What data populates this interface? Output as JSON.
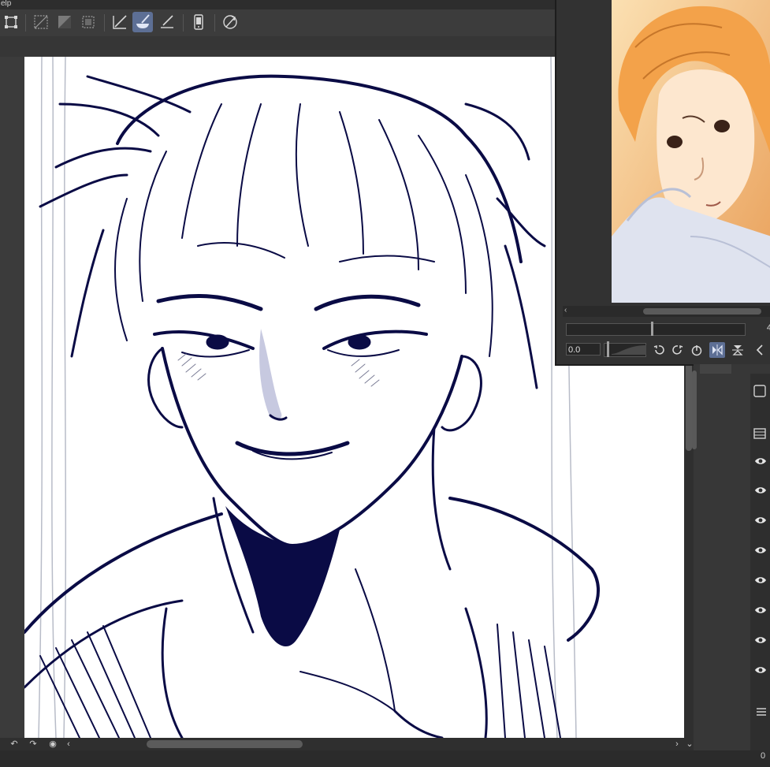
{
  "app": {
    "menu_fragment": "elp"
  },
  "toolbar": {
    "tools": [
      {
        "icon": "transform-icon"
      },
      {
        "icon": "select-clear-icon"
      },
      {
        "icon": "select-invert-icon"
      },
      {
        "icon": "select-extend-icon"
      },
      {
        "icon": "ruler-pen-icon"
      },
      {
        "icon": "brush-icon",
        "active": true
      },
      {
        "icon": "ruler-line-icon"
      },
      {
        "icon": "device-icon"
      },
      {
        "icon": "settings-wand-icon"
      }
    ],
    "active_color": "#5d6f95"
  },
  "navigator": {
    "zoom_fragment": "4",
    "rotation_value": "0.0"
  },
  "layers": {
    "visible_count": 8,
    "footer_value": "0"
  },
  "colors": {
    "ink": "#0a0b45",
    "canvas_bg": "#ffffff",
    "ui_dark": "#3a3a3a",
    "preview_warm": "#f4c78c"
  }
}
